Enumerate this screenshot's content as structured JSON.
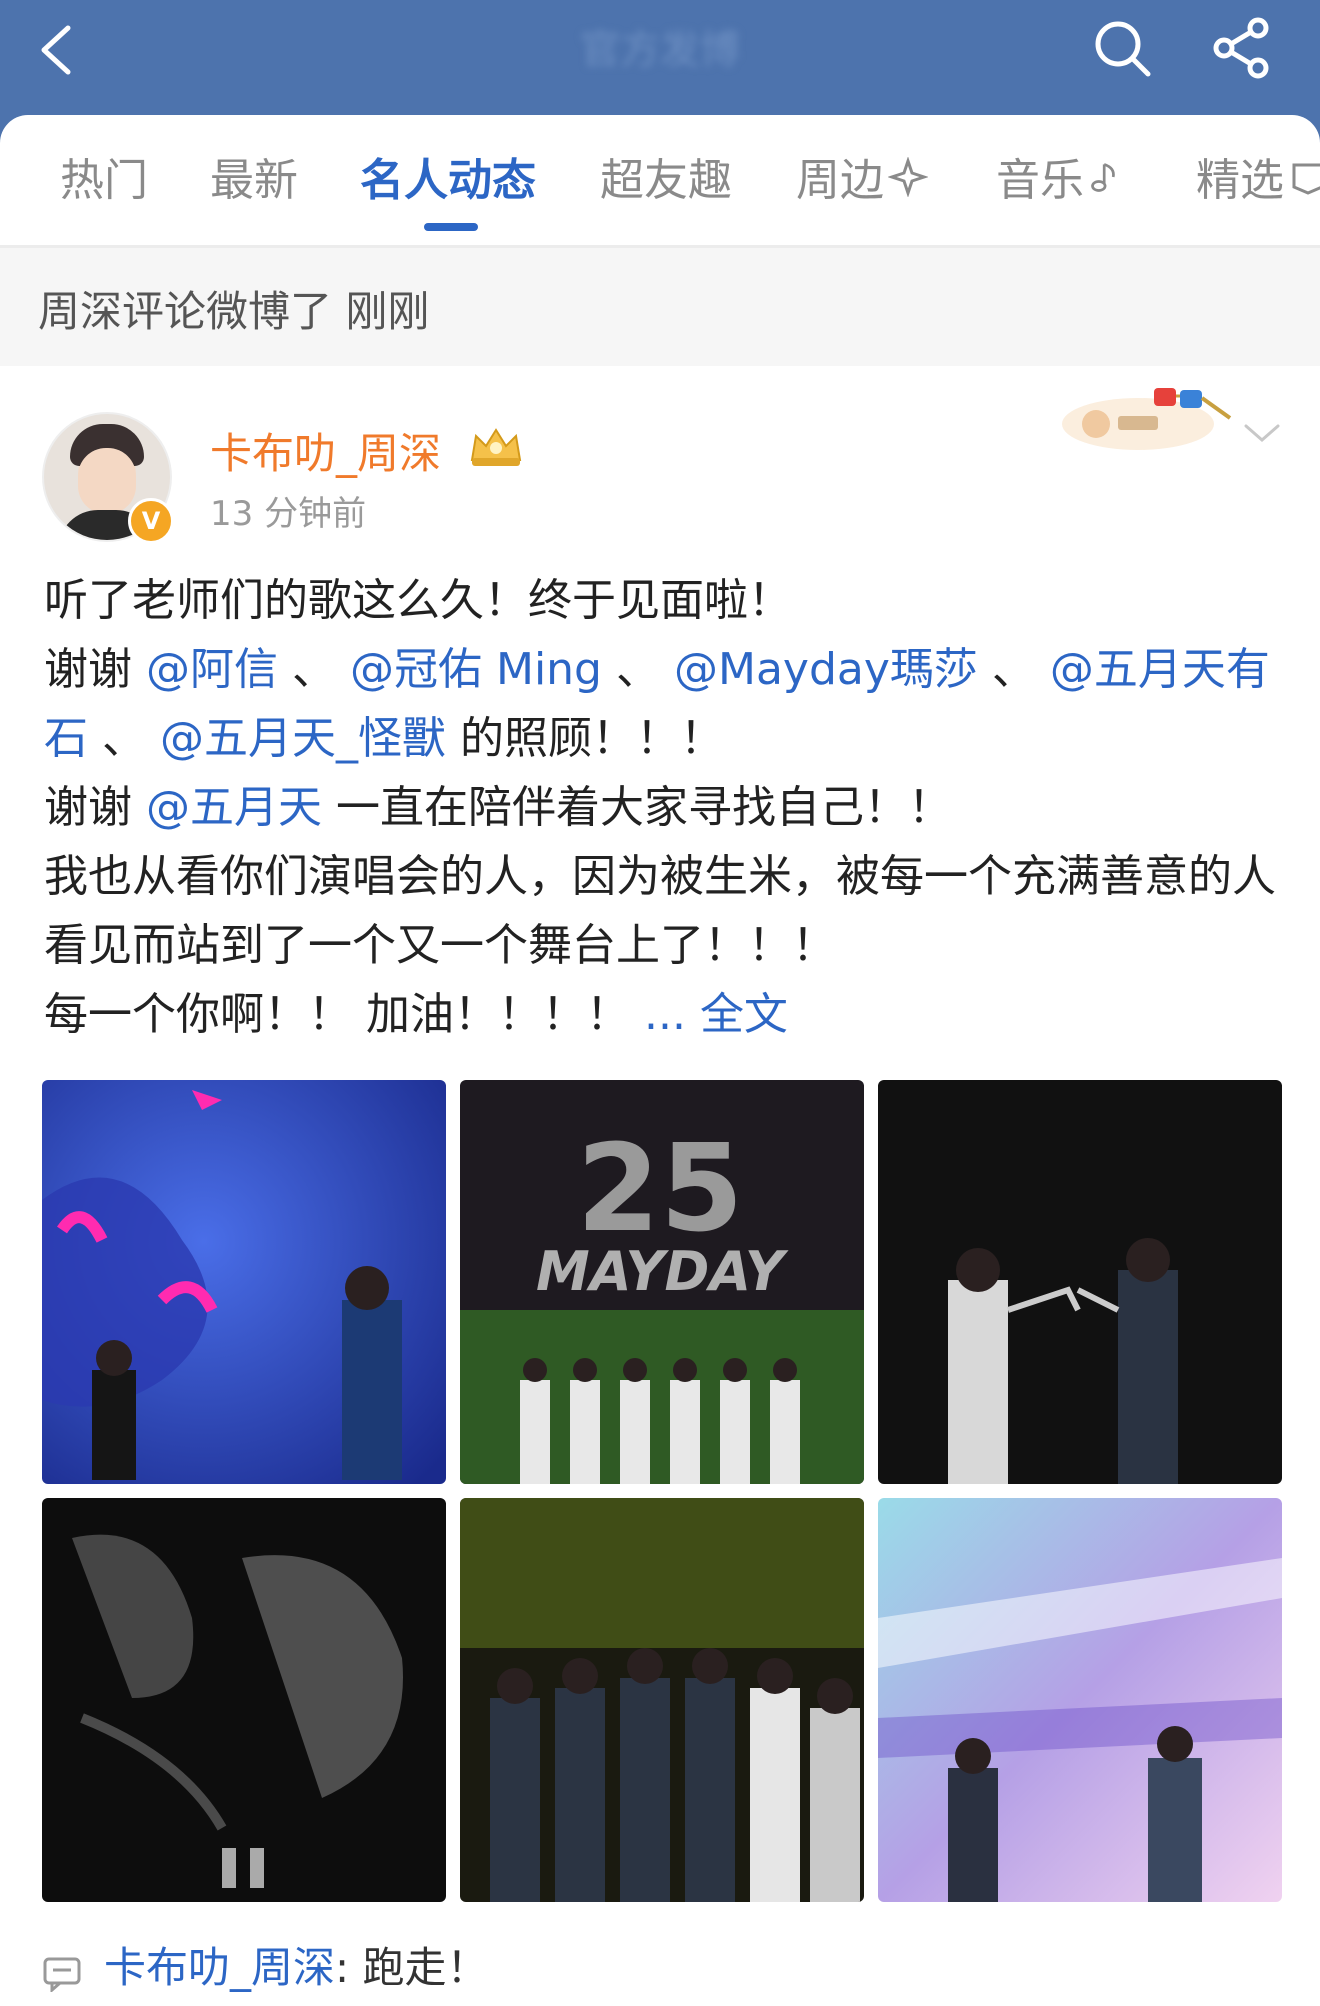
{
  "topbar": {
    "title": "官方发博"
  },
  "tabs": [
    {
      "label": "热门"
    },
    {
      "label": "最新"
    },
    {
      "label": "名人动态"
    },
    {
      "label": "超友趣"
    },
    {
      "label": "周边"
    },
    {
      "label": "音乐"
    },
    {
      "label": "精选"
    }
  ],
  "activity": {
    "text": "周深评论微博了 刚刚"
  },
  "post": {
    "username": "卡布叻_周深",
    "time": "13 分钟前",
    "line1": "听了老师们的歌这么久！终于见面啦！",
    "thanks_prefix": "谢谢 ",
    "mention_1": "@阿信",
    "sep": " 、",
    "mention_2": "@冠佑 Ming",
    "mention_3": "@Mayday瑪莎",
    "mention_4": "@五月天有石",
    "mention_5": "@五月天_怪獸",
    "care_suffix": " 的照顾！！！",
    "thanks2_prefix": "谢谢 ",
    "mention_6": "@五月天",
    "thanks2_suffix": " 一直在陪伴着大家寻找自己！！",
    "line4": "我也从看你们演唱会的人，因为被生米，被每一个充满善意的人看见而站到了一个又一个舞台上了！！！",
    "line5": "每一个你啊！！ 加油！！！！ ",
    "more_ellipsis": "... ",
    "more_label": "全文"
  },
  "comment": {
    "name": "卡布叻_周深",
    "text": ": 跑走！"
  },
  "icons": {
    "back": "back-arrow-icon",
    "search": "search-icon",
    "share": "share-icon",
    "verified": "verified-badge-icon",
    "comment": "comment-icon"
  },
  "colors": {
    "header": "#4d73ad",
    "accent": "#2c66c5",
    "username": "#f07a2b"
  }
}
